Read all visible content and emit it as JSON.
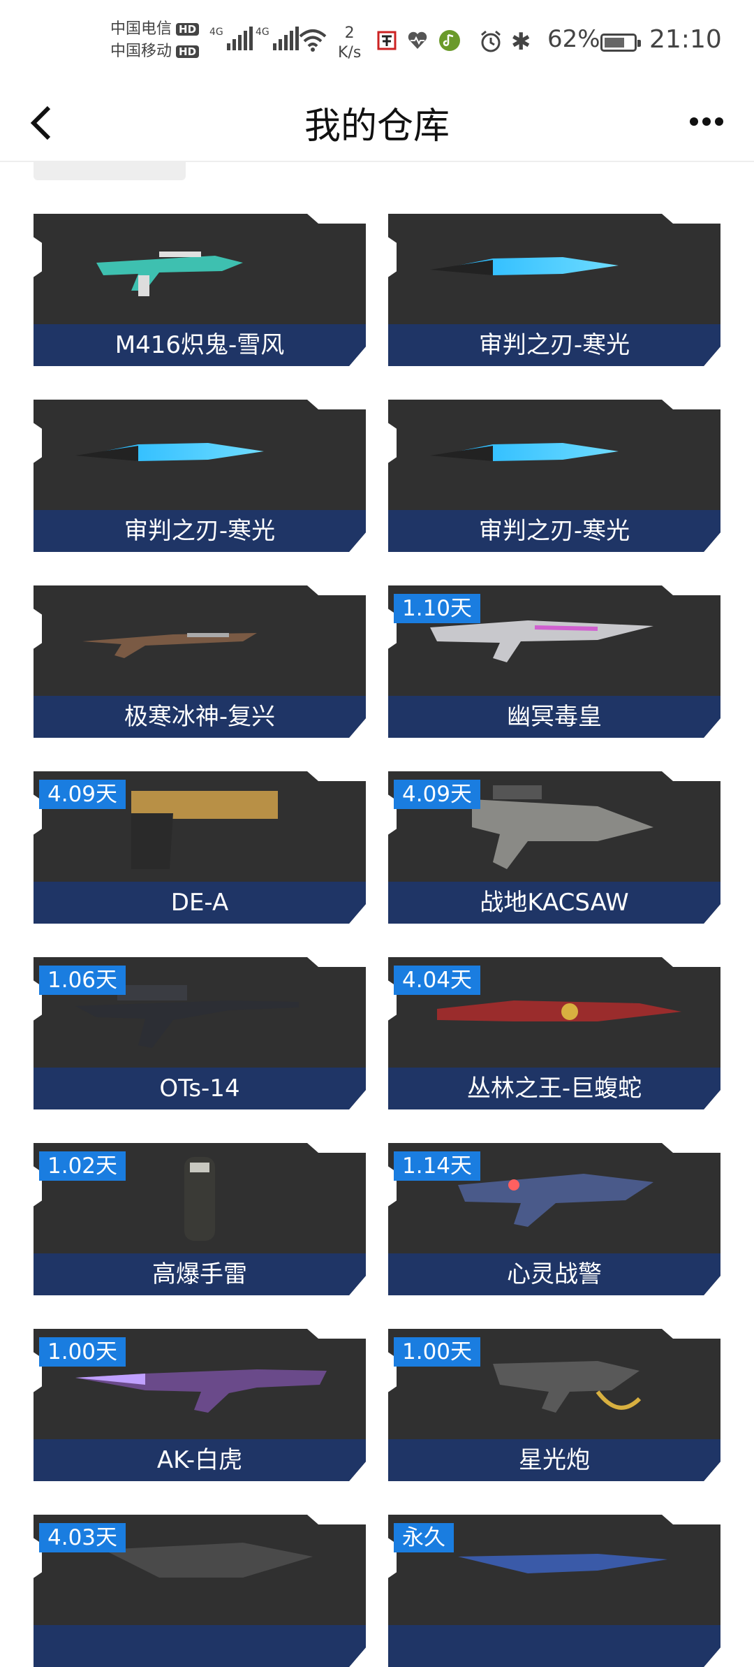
{
  "status_bar": {
    "carrier1": "中国电信",
    "carrier2": "中国移动",
    "hd_label": "HD",
    "network1": "4G",
    "network2": "4G",
    "speed_value": "2",
    "speed_unit": "K/s",
    "battery_pct": "62%",
    "time": "21:10"
  },
  "navbar": {
    "title": "我的仓库"
  },
  "items": [
    {
      "name": "M416炽鬼-雪风",
      "badge": ""
    },
    {
      "name": "审判之刃-寒光",
      "badge": ""
    },
    {
      "name": "审判之刃-寒光",
      "badge": ""
    },
    {
      "name": "审判之刃-寒光",
      "badge": ""
    },
    {
      "name": "极寒冰神-复兴",
      "badge": ""
    },
    {
      "name": "幽冥毒皇",
      "badge": "1.10天"
    },
    {
      "name": "DE-A",
      "badge": "4.09天"
    },
    {
      "name": "战地KACSAW",
      "badge": "4.09天"
    },
    {
      "name": "OTs-14",
      "badge": "1.06天"
    },
    {
      "name": "丛林之王-巨蝮蛇",
      "badge": "4.04天"
    },
    {
      "name": "高爆手雷",
      "badge": "1.02天"
    },
    {
      "name": "心灵战警",
      "badge": "1.14天"
    },
    {
      "name": "AK-白虎",
      "badge": "1.00天"
    },
    {
      "name": "星光炮",
      "badge": "1.00天"
    },
    {
      "name": "",
      "badge": "4.03天"
    },
    {
      "name": "",
      "badge": "永久"
    }
  ],
  "colors": {
    "card_bg": "#303030",
    "label_bg": "#1f3566",
    "badge_bg": "#1a7de0"
  }
}
